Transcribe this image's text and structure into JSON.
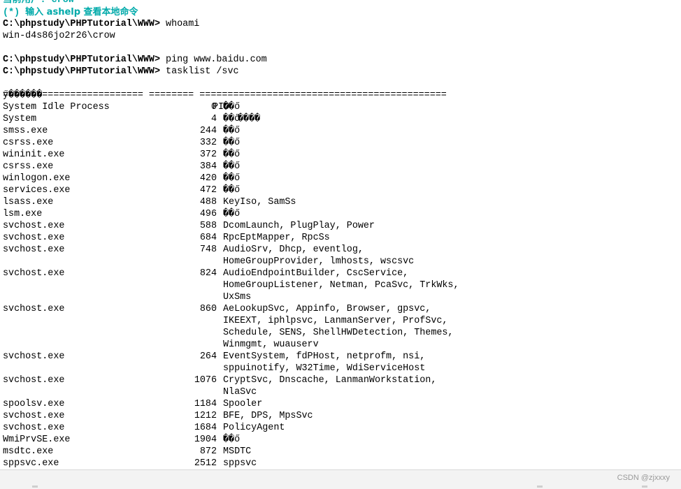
{
  "terminal": {
    "user_line": "当前用户: crow",
    "tip_prefix": "(*) ",
    "tip_text": "输入 ashelp 查看本地命令",
    "prompt": "C:\\phpstudy\\PHPTutorial\\WWW>",
    "commands": [
      {
        "cmd": "whoami",
        "output": "win-d4s86jo2r26\\crow"
      },
      {
        "cmd": "ping www.baidu.com"
      },
      {
        "cmd": "tasklist /svc"
      }
    ],
    "header_name": "ӳ������",
    "header_pid": "PID",
    "header_svc": "����",
    "separator": "========================= ======== ============================================",
    "processes": [
      {
        "name": "System Idle Process",
        "pid": "0",
        "svc": [
          "��ő"
        ]
      },
      {
        "name": "System",
        "pid": "4",
        "svc": [
          "��ő"
        ]
      },
      {
        "name": "smss.exe",
        "pid": "244",
        "svc": [
          "��ő"
        ]
      },
      {
        "name": "csrss.exe",
        "pid": "332",
        "svc": [
          "��ő"
        ]
      },
      {
        "name": "wininit.exe",
        "pid": "372",
        "svc": [
          "��ő"
        ]
      },
      {
        "name": "csrss.exe",
        "pid": "384",
        "svc": [
          "��ő"
        ]
      },
      {
        "name": "winlogon.exe",
        "pid": "420",
        "svc": [
          "��ő"
        ]
      },
      {
        "name": "services.exe",
        "pid": "472",
        "svc": [
          "��ő"
        ]
      },
      {
        "name": "lsass.exe",
        "pid": "488",
        "svc": [
          "KeyIso, SamSs"
        ]
      },
      {
        "name": "lsm.exe",
        "pid": "496",
        "svc": [
          "��ő"
        ]
      },
      {
        "name": "svchost.exe",
        "pid": "588",
        "svc": [
          "DcomLaunch, PlugPlay, Power"
        ]
      },
      {
        "name": "svchost.exe",
        "pid": "684",
        "svc": [
          "RpcEptMapper, RpcSs"
        ]
      },
      {
        "name": "svchost.exe",
        "pid": "748",
        "svc": [
          "AudioSrv, Dhcp, eventlog,",
          "HomeGroupProvider, lmhosts, wscsvc"
        ]
      },
      {
        "name": "svchost.exe",
        "pid": "824",
        "svc": [
          "AudioEndpointBuilder, CscService,",
          "HomeGroupListener, Netman, PcaSvc, TrkWks,",
          "UxSms"
        ]
      },
      {
        "name": "svchost.exe",
        "pid": "860",
        "svc": [
          "AeLookupSvc, Appinfo, Browser, gpsvc,",
          "IKEEXT, iphlpsvc, LanmanServer, ProfSvc,",
          "Schedule, SENS, ShellHWDetection, Themes,",
          "Winmgmt, wuauserv"
        ]
      },
      {
        "name": "svchost.exe",
        "pid": "264",
        "svc": [
          "EventSystem, fdPHost, netprofm, nsi,",
          "sppuinotify, W32Time, WdiServiceHost"
        ]
      },
      {
        "name": "svchost.exe",
        "pid": "1076",
        "svc": [
          "CryptSvc, Dnscache, LanmanWorkstation,",
          "NlaSvc"
        ]
      },
      {
        "name": "spoolsv.exe",
        "pid": "1184",
        "svc": [
          "Spooler"
        ]
      },
      {
        "name": "svchost.exe",
        "pid": "1212",
        "svc": [
          "BFE, DPS, MpsSvc"
        ]
      },
      {
        "name": "svchost.exe",
        "pid": "1684",
        "svc": [
          "PolicyAgent"
        ]
      },
      {
        "name": "WmiPrvSE.exe",
        "pid": "1904",
        "svc": [
          "��ő"
        ]
      },
      {
        "name": "msdtc.exe",
        "pid": "872",
        "svc": [
          "MSDTC"
        ]
      },
      {
        "name": "sppsvc.exe",
        "pid": "2512",
        "svc": [
          "sppsvc"
        ]
      }
    ]
  },
  "footer": {
    "watermark": "CSDN @zjxxxy"
  }
}
